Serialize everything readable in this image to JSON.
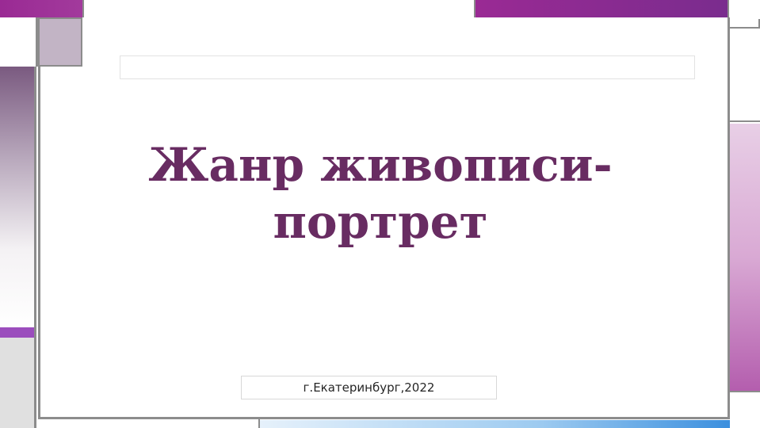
{
  "slide": {
    "title_line1": "Жанр живописи-",
    "title_line2": "портрет",
    "subtitle": "г.Екатеринбург,2022",
    "title_placeholder": ""
  },
  "colors": {
    "title": "#682c62",
    "accent_purple": "#9a2a94",
    "frame_gray": "#8c8c8c",
    "right_gradient_end": "#b45eae",
    "bottom_blue": "#3b8fde"
  }
}
